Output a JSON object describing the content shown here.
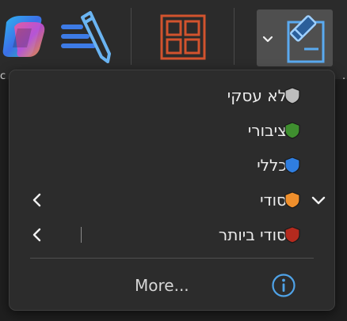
{
  "ribbon": {
    "buttons": [
      {
        "name": "copilot",
        "icon": "copilot-icon"
      },
      {
        "name": "editor",
        "icon": "editor-pen-icon"
      },
      {
        "name": "add-ins",
        "icon": "grid-icon"
      },
      {
        "name": "sensitivity",
        "icon": "sensitivity-icon",
        "selected": true
      }
    ]
  },
  "menu": {
    "items": [
      {
        "label": "לא עסקי",
        "shield_color": "#bdbdbd",
        "submenu": false,
        "checked": false
      },
      {
        "label": "ציבורי",
        "shield_color": "#3f8f2f",
        "submenu": false,
        "checked": false
      },
      {
        "label": "כללי",
        "shield_color": "#2f7ee0",
        "submenu": false,
        "checked": false
      },
      {
        "label": "סודי",
        "shield_color": "#ef8f2c",
        "submenu": true,
        "checked": true
      },
      {
        "label": "סודי ביותר",
        "shield_color": "#b52a1e",
        "submenu": true,
        "checked": false
      }
    ],
    "more_label": "More...",
    "more_icon": "info-icon"
  },
  "colors": {
    "menu_bg": "#2c2c2c",
    "ribbon_bg": "#2b2b2b",
    "selected_btn_bg": "#4f4f4f",
    "accent_blue": "#4fa3e8",
    "addins_orange": "#d2532e"
  }
}
